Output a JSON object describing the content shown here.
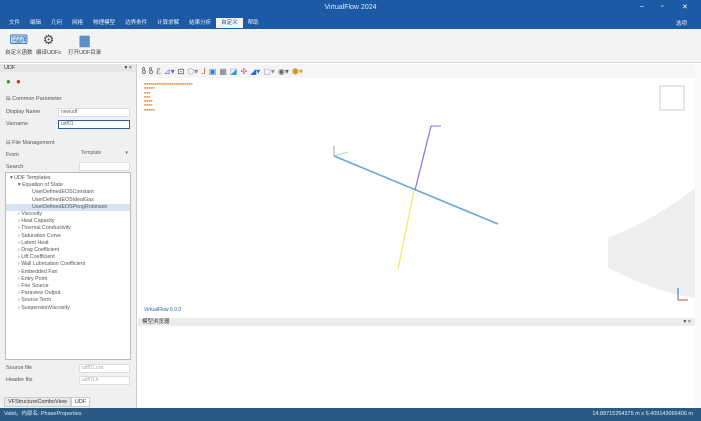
{
  "app": {
    "title": "VirtualFlow 2024",
    "options": "选项"
  },
  "menu": [
    "文件",
    "编辑",
    "几何",
    "网格",
    "物理模型",
    "边界条件",
    "计算求解",
    "结果分析",
    "自定义",
    "帮助"
  ],
  "menu_active": 8,
  "ribbon": [
    {
      "label": "自定义函数",
      "icon": "function-icon"
    },
    {
      "label": "编译UDFs",
      "icon": "gear-icon"
    },
    {
      "label": "打开UDF目录",
      "icon": "folder-icon"
    }
  ],
  "udf_panel": {
    "title": "UDF",
    "common_parameter": "Common Parameter",
    "display_name_label": "Display Name",
    "display_name": "newudf",
    "varname_label": "Varname",
    "varname": "udf01",
    "file_management": "File Management",
    "from_label": "From",
    "from_value": "Template",
    "search_label": "Search",
    "search_value": "",
    "tree": [
      {
        "label": "UDF Templates",
        "level": 0,
        "arrow": "▾"
      },
      {
        "label": "Equation of State",
        "level": 1,
        "arrow": "▾"
      },
      {
        "label": "UserDefinedEOSConstant",
        "level": 2
      },
      {
        "label": "UserDefinedEOSIdealGas",
        "level": 2
      },
      {
        "label": "UserDefinedEOSPengRobinson",
        "level": 2,
        "selected": true
      },
      {
        "label": "Viscosity",
        "level": 1,
        "arrow": "›"
      },
      {
        "label": "Heat Capacity",
        "level": 1,
        "arrow": "›"
      },
      {
        "label": "Thermal Conductivity",
        "level": 1,
        "arrow": "›"
      },
      {
        "label": "Saturation Curve",
        "level": 1,
        "arrow": "›"
      },
      {
        "label": "Latent Heat",
        "level": 1,
        "arrow": "›"
      },
      {
        "label": "Drag Coefficient",
        "level": 1,
        "arrow": "›"
      },
      {
        "label": "Lift Coefficient",
        "level": 1,
        "arrow": "›"
      },
      {
        "label": "Wall Lubrication Coefficient",
        "level": 1,
        "arrow": "›"
      },
      {
        "label": "Embedded Fan",
        "level": 1,
        "arrow": "›"
      },
      {
        "label": "Entry Point",
        "level": 1,
        "arrow": "›"
      },
      {
        "label": "Fire Source",
        "level": 1,
        "arrow": "›"
      },
      {
        "label": "Paraview Output",
        "level": 1,
        "arrow": "›"
      },
      {
        "label": "Source Term",
        "level": 1,
        "arrow": "›"
      },
      {
        "label": "SuspensionViscosity",
        "level": 1,
        "arrow": "›"
      }
    ],
    "source_file_label": "Source file",
    "source_file": "udf01.cxx",
    "header_file_label": "Header file",
    "header_file": "udf01.h"
  },
  "left_tabs": [
    "VFStructureComboView",
    "UDF"
  ],
  "viewport": {
    "label": "VirtualFlow 6.0.0"
  },
  "bottom_panel": {
    "title": "模型浏览器"
  },
  "status": {
    "left": "Valid。内部名: PhaseProperties",
    "right": "14.88715254375 m x 6.409143066406 m"
  },
  "colors": {
    "titlebar": "#1d5aa6",
    "statusbar": "#2b5a85",
    "accent": "#2d5d96"
  }
}
